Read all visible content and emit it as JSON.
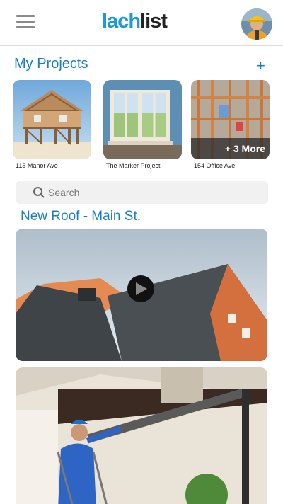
{
  "app": {
    "logo_part1": "lach",
    "logo_part2": "list"
  },
  "projects": {
    "title": "My Projects",
    "add_label": "+",
    "items": [
      {
        "caption": "115 Manor Ave"
      },
      {
        "caption": "The Marker Project"
      },
      {
        "caption": "154 Office Ave",
        "badge": "+ 3 More"
      }
    ]
  },
  "search": {
    "placeholder": "Search"
  },
  "feed": {
    "title": "New Roof - Main St."
  },
  "colors": {
    "accent": "#1a7fc1",
    "logo_blue": "#1a9ad6"
  },
  "icons": {
    "menu": "hamburger-icon",
    "add": "plus-icon",
    "search": "search-icon",
    "play": "play-icon"
  }
}
